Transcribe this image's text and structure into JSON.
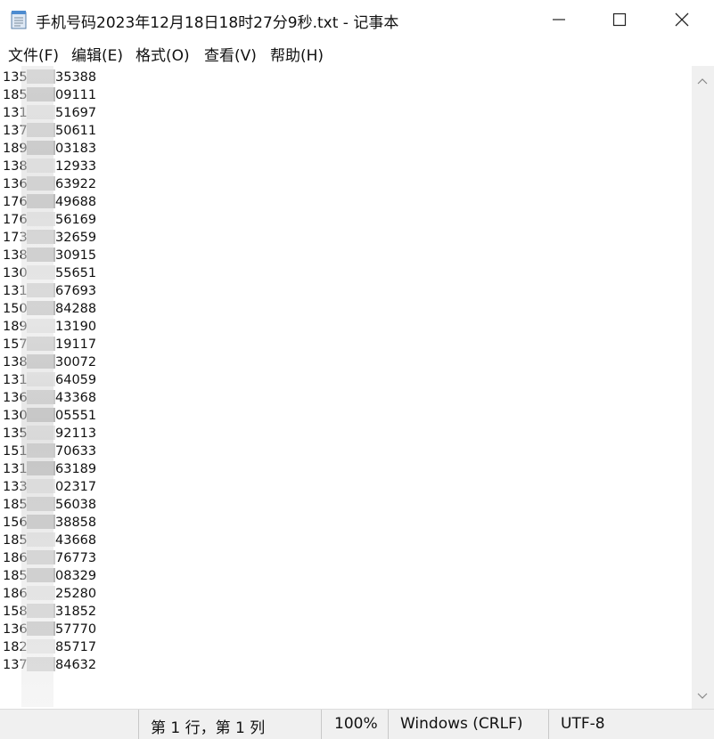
{
  "window": {
    "title": "手机号码2023年12月18日18时27分9秒.txt - 记事本"
  },
  "menu": {
    "items": [
      {
        "label": "文件(F)"
      },
      {
        "label": "编辑(E)"
      },
      {
        "label": "格式(O)"
      },
      {
        "label": "查看(V)"
      },
      {
        "label": "帮助(H)"
      }
    ]
  },
  "editor": {
    "lines": [
      {
        "prefix": "135",
        "suffix": "35388"
      },
      {
        "prefix": "185",
        "suffix": "09111"
      },
      {
        "prefix": "131",
        "suffix": "51697"
      },
      {
        "prefix": "137",
        "suffix": "50611"
      },
      {
        "prefix": "189",
        "suffix": "03183"
      },
      {
        "prefix": "138",
        "suffix": "12933"
      },
      {
        "prefix": "136",
        "suffix": "63922"
      },
      {
        "prefix": "176",
        "suffix": "49688"
      },
      {
        "prefix": "176",
        "suffix": "56169"
      },
      {
        "prefix": "173",
        "suffix": "32659"
      },
      {
        "prefix": "138",
        "suffix": "30915"
      },
      {
        "prefix": "130",
        "suffix": "55651"
      },
      {
        "prefix": "131",
        "suffix": "67693"
      },
      {
        "prefix": "150",
        "suffix": "84288"
      },
      {
        "prefix": "189",
        "suffix": "13190"
      },
      {
        "prefix": "157",
        "suffix": "19117"
      },
      {
        "prefix": "138",
        "suffix": "30072"
      },
      {
        "prefix": "131",
        "suffix": "64059"
      },
      {
        "prefix": "136",
        "suffix": "43368"
      },
      {
        "prefix": "130",
        "suffix": "05551"
      },
      {
        "prefix": "135",
        "suffix": "92113"
      },
      {
        "prefix": "151",
        "suffix": "70633"
      },
      {
        "prefix": "131",
        "suffix": "63189"
      },
      {
        "prefix": "133",
        "suffix": "02317"
      },
      {
        "prefix": "185",
        "suffix": "56038"
      },
      {
        "prefix": "156",
        "suffix": "38858"
      },
      {
        "prefix": "185",
        "suffix": "43668"
      },
      {
        "prefix": "186",
        "suffix": "76773"
      },
      {
        "prefix": "185",
        "suffix": "08329"
      },
      {
        "prefix": "186",
        "suffix": "25280"
      },
      {
        "prefix": "158",
        "suffix": "31852"
      },
      {
        "prefix": "136",
        "suffix": "57770"
      },
      {
        "prefix": "182",
        "suffix": "85717"
      },
      {
        "prefix": "137",
        "suffix": "84632"
      }
    ]
  },
  "statusbar": {
    "position": "第 1 行，第 1 列",
    "zoom": "100%",
    "line_ending": "Windows (CRLF)",
    "encoding": "UTF-8"
  }
}
